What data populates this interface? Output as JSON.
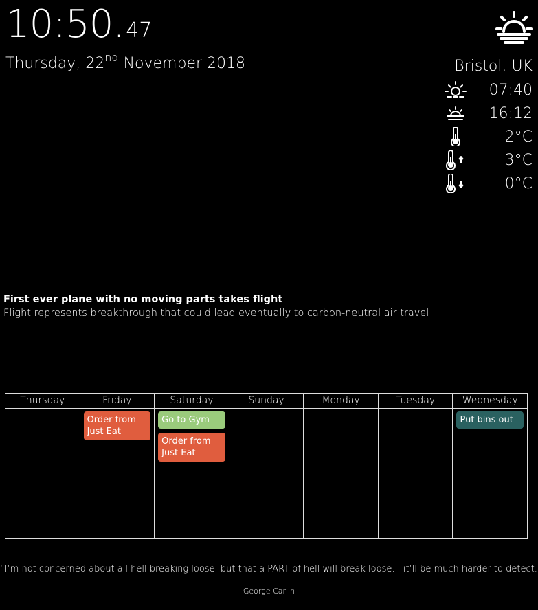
{
  "clock": {
    "hours_minutes": "10:50.",
    "seconds": "47"
  },
  "date": {
    "weekday_day": "Thursday, 22",
    "ordinal": "nd",
    "month_year": " November 2018"
  },
  "weather": {
    "current_icon": "sunrise-icon",
    "location": "Bristol, UK",
    "rows": [
      {
        "icon": "sunrise-icon",
        "value": "07:40"
      },
      {
        "icon": "sunset-icon",
        "value": "16:12"
      },
      {
        "icon": "thermometer-icon",
        "value": "2°C"
      },
      {
        "icon": "thermometer-high-icon",
        "value": "3°C"
      },
      {
        "icon": "thermometer-low-icon",
        "value": "0°C"
      }
    ]
  },
  "news": {
    "headline": "First ever plane with no moving parts takes flight",
    "summary": "Flight represents breakthrough that could lead eventually to carbon-neutral air travel"
  },
  "calendar": {
    "days": [
      {
        "name": "Thursday",
        "events": []
      },
      {
        "name": "Friday",
        "events": [
          {
            "title": "Order from Just Eat",
            "color": "#e05d3e",
            "done": false
          }
        ]
      },
      {
        "name": "Saturday",
        "events": [
          {
            "title": "Go to Gym",
            "color": "#9acb7c",
            "done": true
          },
          {
            "title": "Order from Just Eat",
            "color": "#e05d3e",
            "done": false
          }
        ]
      },
      {
        "name": "Sunday",
        "events": []
      },
      {
        "name": "Monday",
        "events": []
      },
      {
        "name": "Tuesday",
        "events": []
      },
      {
        "name": "Wednesday",
        "events": [
          {
            "title": "Put bins out",
            "color": "#2a6160",
            "done": false
          }
        ]
      }
    ]
  },
  "quote": {
    "text": "“I’m not concerned about all hell breaking loose, but that a PART of hell will break loose... it’ll be much harder to detect.”",
    "author": "George Carlin"
  }
}
